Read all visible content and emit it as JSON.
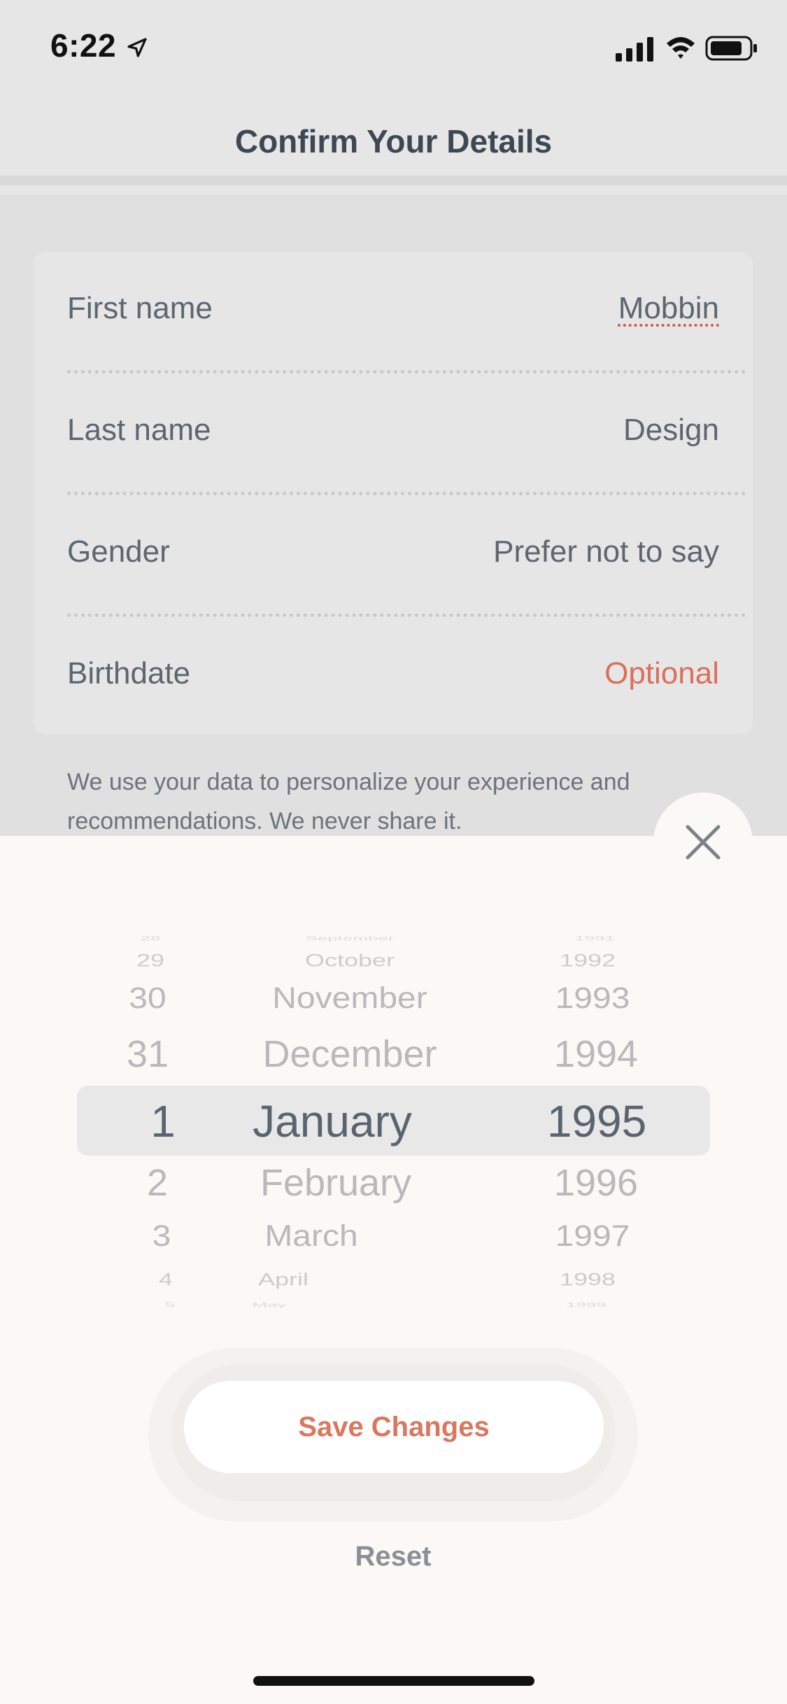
{
  "status_bar": {
    "time": "6:22"
  },
  "header": {
    "title": "Confirm Your Details"
  },
  "form": {
    "rows": [
      {
        "label": "First name",
        "value": "Mobbin"
      },
      {
        "label": "Last name",
        "value": "Design"
      },
      {
        "label": "Gender",
        "value": "Prefer not to say"
      },
      {
        "label": "Birthdate",
        "value": "Optional"
      }
    ],
    "privacy_note": "We use your data to personalize your experience and recommendations. We never share it."
  },
  "picker": {
    "day": [
      "28",
      "29",
      "30",
      "31",
      "1",
      "2",
      "3",
      "4",
      "5"
    ],
    "month": [
      "September",
      "October",
      "November",
      "December",
      "January",
      "February",
      "March",
      "April",
      "May"
    ],
    "year": [
      "1991",
      "1992",
      "1993",
      "1994",
      "1995",
      "1996",
      "1997",
      "1998",
      "1999"
    ],
    "selected": {
      "day": "1",
      "month": "January",
      "year": "1995"
    }
  },
  "actions": {
    "save_label": "Save Changes",
    "reset_label": "Reset"
  },
  "colors": {
    "accent": "#d9785f",
    "optional": "#d9705a",
    "sheet_bg": "#faf9f6"
  }
}
